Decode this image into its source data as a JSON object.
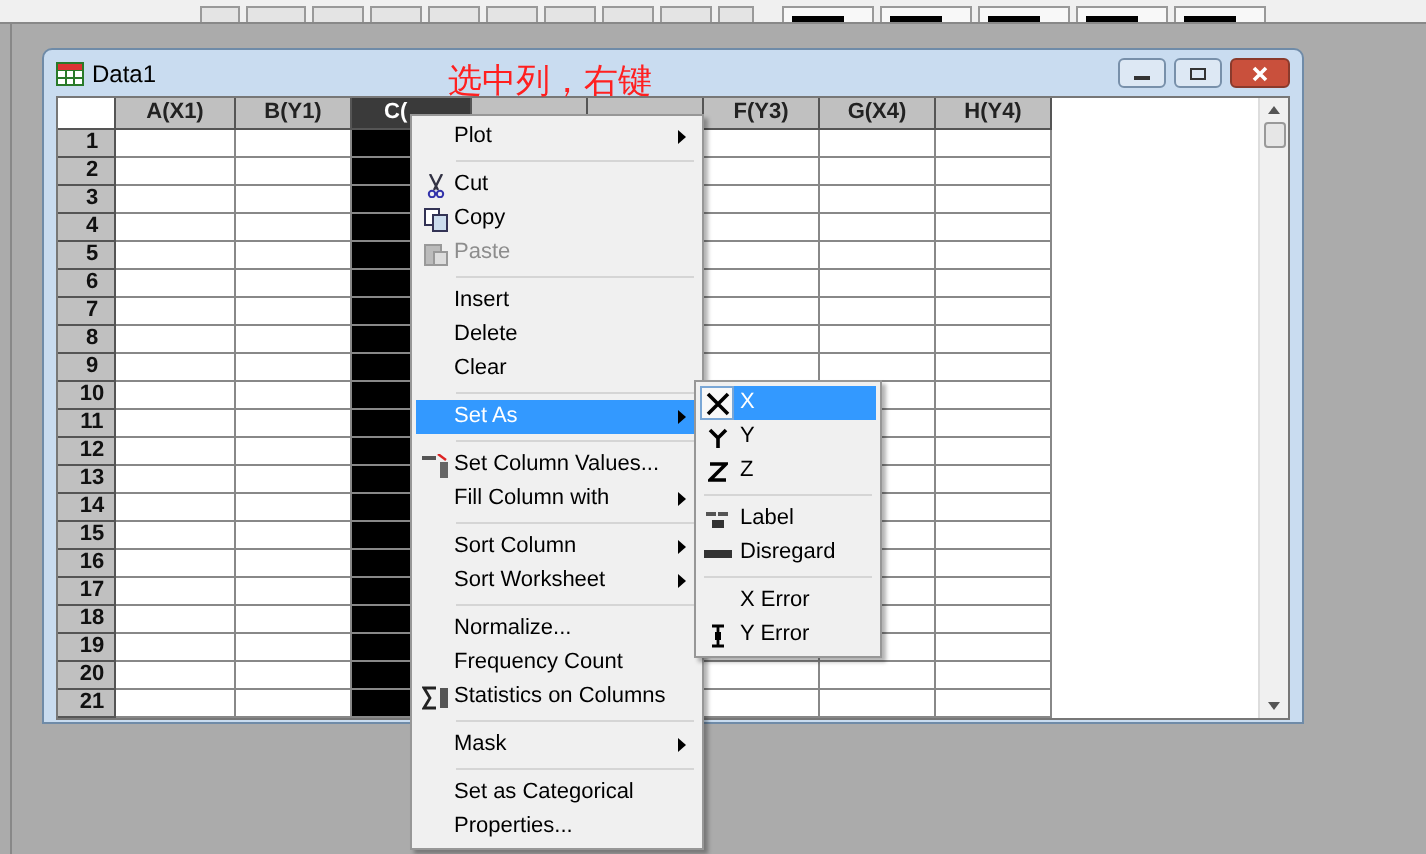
{
  "window": {
    "title": "Data1"
  },
  "annotation": "选中列，右键",
  "columns": [
    {
      "label": "A(X1)",
      "selected": false
    },
    {
      "label": "B(Y1)",
      "selected": false
    },
    {
      "label": "C(",
      "selected": true
    },
    {
      "selected": false
    },
    {
      "selected": false
    },
    {
      "label": "F(Y3)",
      "selected": false
    },
    {
      "label": "G(X4)",
      "selected": false
    },
    {
      "label": "H(Y4)",
      "selected": false
    }
  ],
  "rows": [
    "1",
    "2",
    "3",
    "4",
    "5",
    "6",
    "7",
    "8",
    "9",
    "10",
    "11",
    "12",
    "13",
    "14",
    "15",
    "16",
    "17",
    "18",
    "19",
    "20",
    "21"
  ],
  "context_menu": [
    {
      "kind": "item",
      "label": "Plot",
      "submenu": true,
      "disabled": false,
      "selected": false
    },
    {
      "kind": "separator"
    },
    {
      "kind": "item",
      "label": "Cut",
      "submenu": false,
      "disabled": false,
      "selected": false
    },
    {
      "kind": "item",
      "label": "Copy",
      "submenu": false,
      "disabled": false,
      "selected": false
    },
    {
      "kind": "item",
      "label": "Paste",
      "submenu": false,
      "disabled": true,
      "selected": false
    },
    {
      "kind": "separator"
    },
    {
      "kind": "item",
      "label": "Insert",
      "submenu": false,
      "disabled": false,
      "selected": false
    },
    {
      "kind": "item",
      "label": "Delete",
      "submenu": false,
      "disabled": false,
      "selected": false
    },
    {
      "kind": "item",
      "label": "Clear",
      "submenu": false,
      "disabled": false,
      "selected": false
    },
    {
      "kind": "separator"
    },
    {
      "kind": "item",
      "label": "Set As",
      "submenu": true,
      "disabled": false,
      "selected": true
    },
    {
      "kind": "separator"
    },
    {
      "kind": "item",
      "label": "Set Column Values...",
      "submenu": false,
      "disabled": false,
      "selected": false
    },
    {
      "kind": "item",
      "label": "Fill Column with",
      "submenu": true,
      "disabled": false,
      "selected": false
    },
    {
      "kind": "separator"
    },
    {
      "kind": "item",
      "label": "Sort Column",
      "submenu": true,
      "disabled": false,
      "selected": false
    },
    {
      "kind": "item",
      "label": "Sort Worksheet",
      "submenu": true,
      "disabled": false,
      "selected": false
    },
    {
      "kind": "separator"
    },
    {
      "kind": "item",
      "label": "Normalize...",
      "submenu": false,
      "disabled": false,
      "selected": false
    },
    {
      "kind": "item",
      "label": "Frequency Count",
      "submenu": false,
      "disabled": false,
      "selected": false
    },
    {
      "kind": "item",
      "label": "Statistics on Columns",
      "submenu": false,
      "disabled": false,
      "selected": false
    },
    {
      "kind": "separator"
    },
    {
      "kind": "item",
      "label": "Mask",
      "submenu": true,
      "disabled": false,
      "selected": false
    },
    {
      "kind": "separator"
    },
    {
      "kind": "item",
      "label": "Set as Categorical",
      "submenu": false,
      "disabled": false,
      "selected": false
    },
    {
      "kind": "item",
      "label": "Properties...",
      "submenu": false,
      "disabled": false,
      "selected": false
    }
  ],
  "submenu": [
    {
      "kind": "item",
      "label": "X",
      "selected": true
    },
    {
      "kind": "item",
      "label": "Y",
      "selected": false
    },
    {
      "kind": "item",
      "label": "Z",
      "selected": false
    },
    {
      "kind": "separator"
    },
    {
      "kind": "item",
      "label": "Label",
      "selected": false
    },
    {
      "kind": "item",
      "label": "Disregard",
      "selected": false
    },
    {
      "kind": "separator"
    },
    {
      "kind": "item",
      "label": "X Error",
      "selected": false
    },
    {
      "kind": "item",
      "label": "Y Error",
      "selected": false
    }
  ]
}
